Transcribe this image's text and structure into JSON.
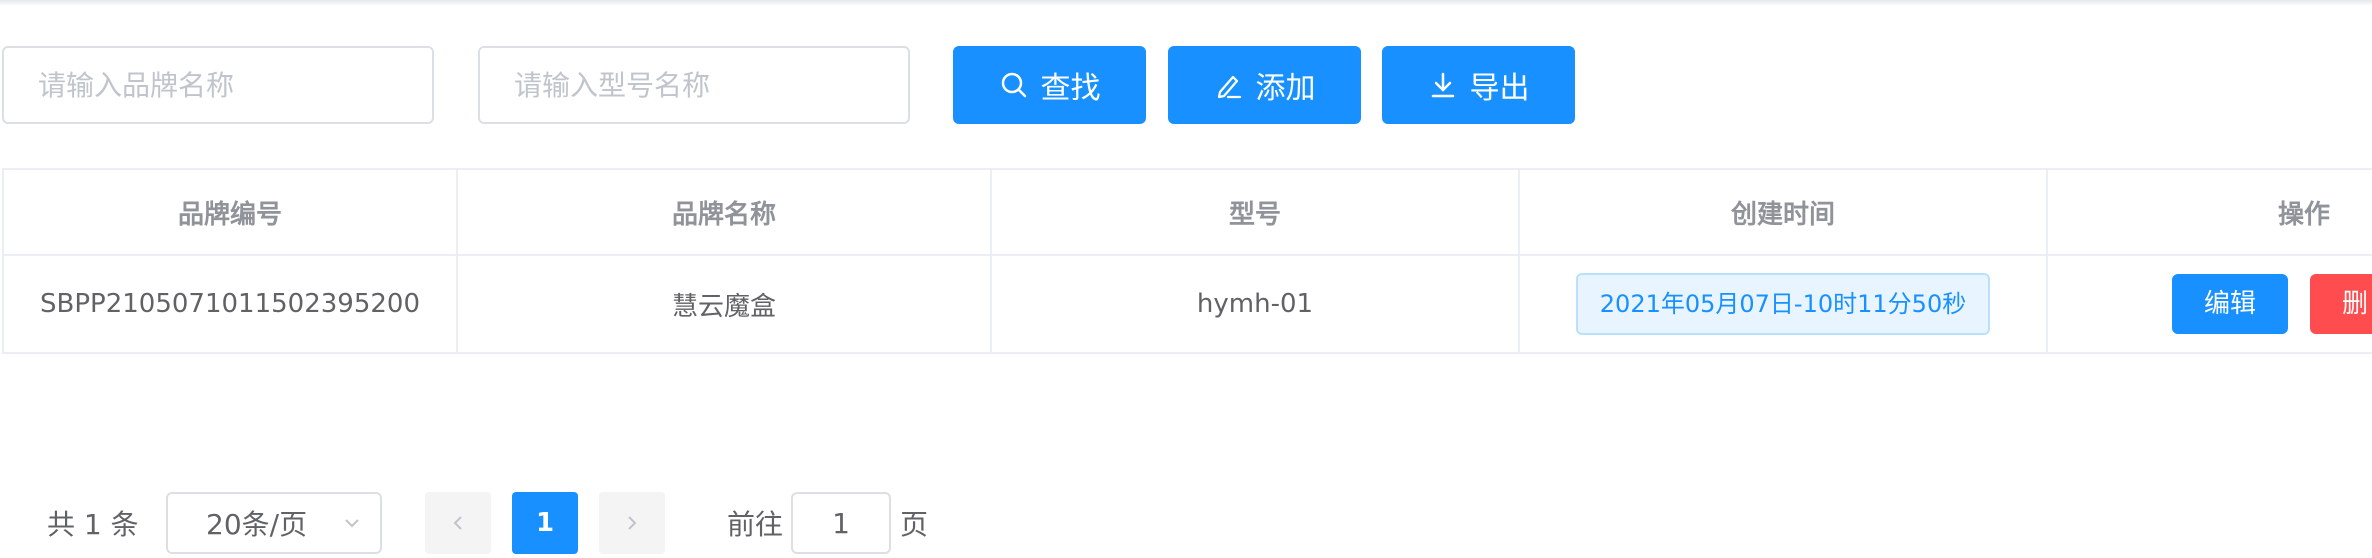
{
  "search": {
    "brand_placeholder": "请输入品牌名称",
    "model_placeholder": "请输入型号名称",
    "find_label": "查找",
    "add_label": "添加",
    "export_label": "导出"
  },
  "table": {
    "headers": [
      "品牌编号",
      "品牌名称",
      "型号",
      "创建时间",
      "操作"
    ],
    "rows": [
      {
        "brand_id": "SBPP2105071011502395200",
        "brand_name": "慧云魔盒",
        "model": "hymh-01",
        "created": "2021年05月07日-10时11分50秒",
        "edit_label": "编辑",
        "delete_label": "删"
      }
    ]
  },
  "pagination": {
    "total_text": "共 1 条",
    "page_size": "20条/页",
    "current_page": "1",
    "goto_label": "前往",
    "goto_value": "1",
    "page_suffix": "页"
  },
  "colors": {
    "primary": "#1890ff",
    "danger": "#ff4d4f",
    "tag_bg": "#e8f4ff"
  }
}
